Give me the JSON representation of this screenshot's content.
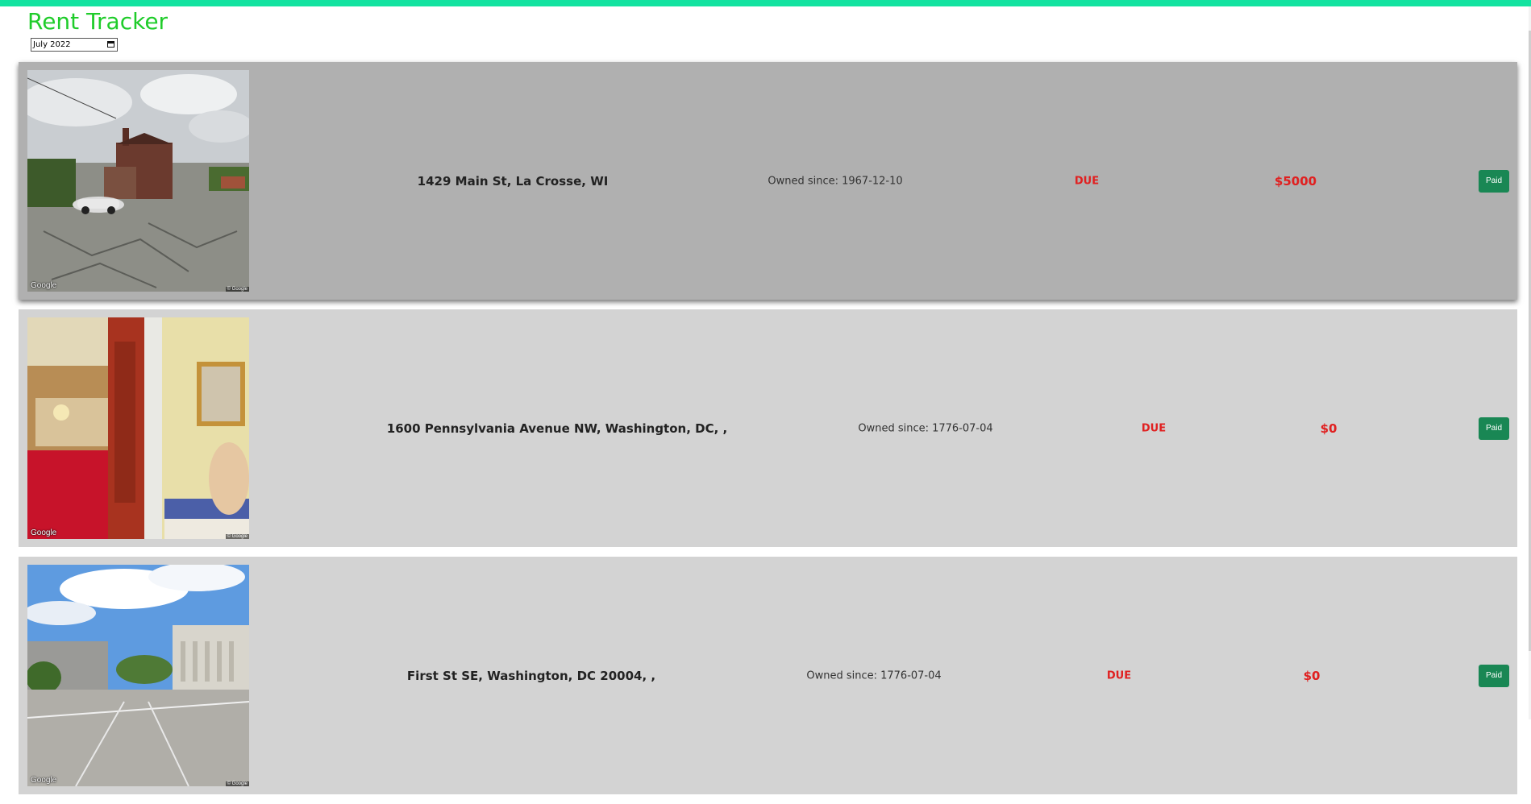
{
  "app": {
    "title": "Rent Tracker",
    "accent_color": "#13e3a0",
    "title_color": "#1fcc2a"
  },
  "month_picker": {
    "value": "July 2022",
    "icon": "calendar-icon"
  },
  "properties": [
    {
      "address": "1429 Main St, La Crosse, WI",
      "owned_since": "Owned since: 1967-12-10",
      "status": "DUE",
      "amount": "$5000",
      "paid_label": "Paid",
      "image_brand": "Google",
      "image_copyright": "© Google",
      "highlighted": true
    },
    {
      "address": "1600 Pennsylvania Avenue NW, Washington, DC, ,",
      "owned_since": "Owned since: 1776-07-04",
      "status": "DUE",
      "amount": "$0",
      "paid_label": "Paid",
      "image_brand": "Google",
      "image_copyright": "© Google",
      "highlighted": false
    },
    {
      "address": "First St SE, Washington, DC 20004, ,",
      "owned_since": "Owned since: 1776-07-04",
      "status": "DUE",
      "amount": "$0",
      "paid_label": "Paid",
      "image_brand": "Google",
      "image_copyright": "© Google",
      "highlighted": false
    }
  ],
  "colors": {
    "due_red": "#e02020",
    "paid_green": "#198754",
    "card_bg": "#d3d3d3",
    "card_active_bg": "#b0b0b0"
  }
}
